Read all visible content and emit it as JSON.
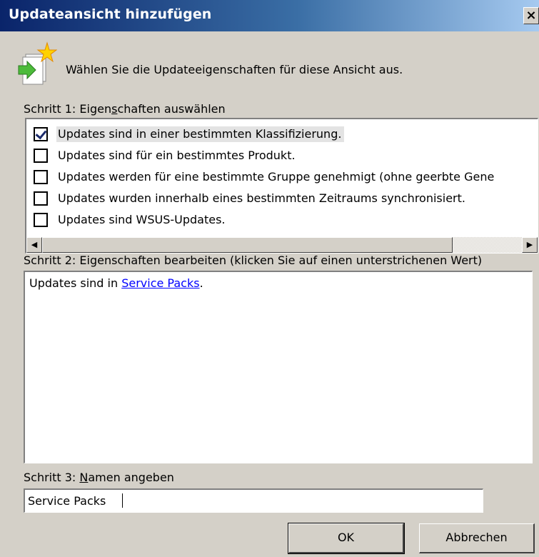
{
  "window": {
    "title": "Updateansicht hinzufügen",
    "close_glyph": "×"
  },
  "header": {
    "icon": "update-view-wizard-icon",
    "instruction": "Wählen Sie die Updateeigenschaften für diese Ansicht aus."
  },
  "step1": {
    "label_before": "Schritt 1: Eigen",
    "label_accel": "s",
    "label_after": "chaften auswählen",
    "items": [
      {
        "label": "Updates sind in einer bestimmten Klassifizierung.",
        "checked": true,
        "selected": true
      },
      {
        "label": "Updates sind für ein bestimmtes Produkt.",
        "checked": false,
        "selected": false
      },
      {
        "label": "Updates werden für eine bestimmte Gruppe genehmigt (ohne geerbte Gene",
        "checked": false,
        "selected": false
      },
      {
        "label": "Updates wurden innerhalb eines bestimmten Zeitraums synchronisiert.",
        "checked": false,
        "selected": false
      },
      {
        "label": "Updates sind WSUS-Updates.",
        "checked": false,
        "selected": false
      }
    ]
  },
  "step2": {
    "label": "Schritt 2: Eigenschaften bearbeiten (klicken Sie auf einen unterstrichenen Wert)",
    "text_before": "Updates sind in ",
    "link": "Service Packs",
    "text_after": "."
  },
  "step3": {
    "label_before": "Schritt 3: ",
    "label_accel": "N",
    "label_after": "amen angeben",
    "value": "Service Packs"
  },
  "buttons": {
    "ok": "OK",
    "cancel": "Abbrechen"
  },
  "scrollbar": {
    "left_glyph": "◀",
    "right_glyph": "▶"
  }
}
